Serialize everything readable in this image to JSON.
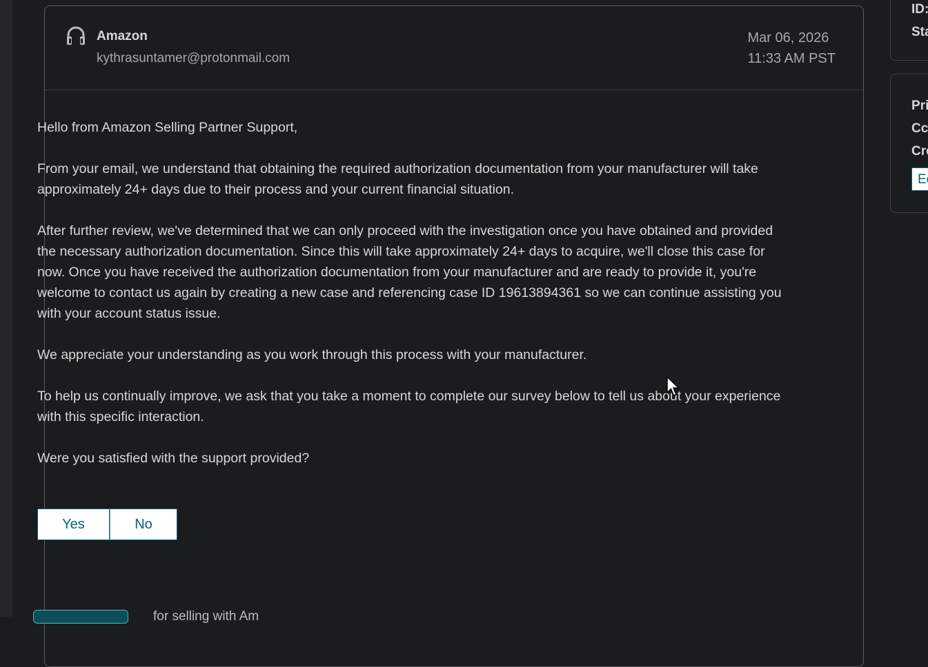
{
  "message": {
    "sender_name": "Amazon",
    "sender_email": "kythrasuntamer@protonmail.com",
    "date": "Mar 06, 2026",
    "time": "11:33 AM PST",
    "body": [
      "Hello from Amazon Selling Partner Support,",
      "From your email, we understand that obtaining the required authorization documentation from your manufacturer will take approximately 24+ days due to their process and your current financial situation.",
      "After further review, we've determined that we can only proceed with the investigation once you have obtained and provided the necessary authorization documentation. Since this will take approximately 24+ days to acquire, we'll close this case for now. Once you have received the authorization documentation from your manufacturer and are ready to provide it, you're welcome to contact us again by creating a new case and referencing case ID 19613894361 so we can continue assisting you with your account status issue.",
      "We appreciate your understanding as you work through this process with your manufacturer.",
      "To help us continually improve, we ask that you take a moment to complete our survey below to tell us about your experience with this specific interaction.",
      "Were you satisfied with the support provided?"
    ],
    "survey": {
      "yes_label": "Yes",
      "no_label": "No"
    },
    "footer_partial": "for selling with Am"
  },
  "sidebar": {
    "top_labels": [
      "ID:",
      "Sta"
    ],
    "mid_labels": [
      "Pri",
      "Cc:",
      "Cre"
    ],
    "input_value": "Ec"
  },
  "colors": {
    "background": "#1b1c1e",
    "accent": "#0a6272",
    "text": "#d8d8d8"
  },
  "icons": {
    "sender_icon": "headset-icon",
    "pointer": "mouse-cursor-icon"
  }
}
